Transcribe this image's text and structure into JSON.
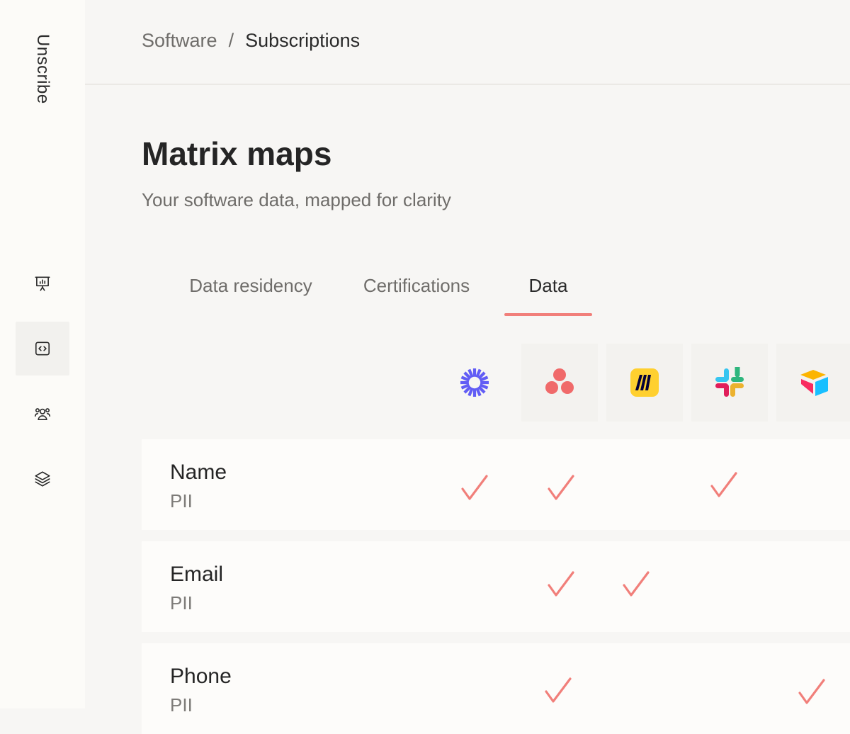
{
  "app": {
    "brand": "Unscribe"
  },
  "sidebar": {
    "items": [
      {
        "icon": "presentation-chart-icon",
        "active": false
      },
      {
        "icon": "code-icon",
        "active": true
      },
      {
        "icon": "users-icon",
        "active": false
      },
      {
        "icon": "layers-icon",
        "active": false
      }
    ]
  },
  "breadcrumb": {
    "parent": "Software",
    "separator": "/",
    "current": "Subscriptions"
  },
  "page": {
    "title": "Matrix maps",
    "subtitle": "Your software data, mapped for clarity"
  },
  "tabs": [
    {
      "label": "Data residency",
      "active": false
    },
    {
      "label": "Certifications",
      "active": false
    },
    {
      "label": "Data",
      "active": true
    }
  ],
  "apps": [
    {
      "icon": "loom-logo-icon"
    },
    {
      "icon": "asana-logo-icon"
    },
    {
      "icon": "miro-logo-icon"
    },
    {
      "icon": "slack-logo-icon"
    },
    {
      "icon": "airtable-logo-icon"
    }
  ],
  "rows": [
    {
      "name": "Name",
      "category": "PII",
      "checks": [
        true,
        true,
        false,
        true,
        false
      ]
    },
    {
      "name": "Email",
      "category": "PII",
      "checks": [
        false,
        true,
        true,
        false,
        false
      ]
    },
    {
      "name": "Phone",
      "category": "PII",
      "checks": [
        false,
        true,
        false,
        false,
        true
      ]
    }
  ],
  "colors": {
    "accent": "#f17f7a",
    "loom": "#625df5",
    "asana": "#f06a6a",
    "miro": "#ffd02f",
    "airtable_red": "#f82b60",
    "airtable_yellow": "#fcb400",
    "airtable_blue": "#18bfff"
  }
}
